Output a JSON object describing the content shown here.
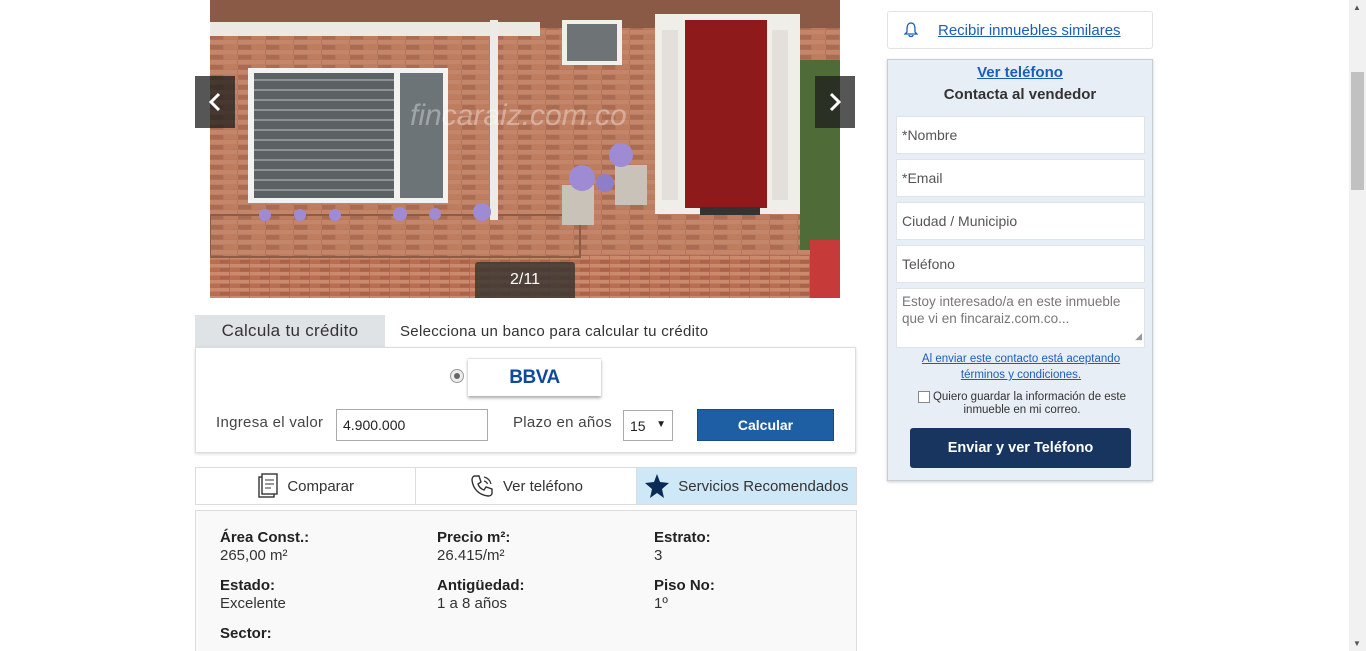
{
  "gallery": {
    "counter": "2/11",
    "watermark": "fincaraiz.com.co",
    "prev_icon": "chevron-left-icon",
    "next_icon": "chevron-right-icon"
  },
  "credit": {
    "tab_label": "Calcula tu crédito",
    "subtitle": "Selecciona un banco para calcular tu crédito",
    "bank_name": "BBVA",
    "value_label": "Ingresa el valor",
    "value": "4.900.000",
    "term_label": "Plazo en años",
    "term_value": "15",
    "calc_button": "Calcular"
  },
  "actions": {
    "compare": "Comparar",
    "phone": "Ver teléfono",
    "services": "Servicios Recomendados"
  },
  "details": {
    "area_label": "Área Const.:",
    "area_value": "265,00 m²",
    "price_m2_label": "Precio m²:",
    "price_m2_value": "26.415/m²",
    "estrato_label": "Estrato:",
    "estrato_value": "3",
    "estado_label": "Estado:",
    "estado_value": "Excelente",
    "antiguedad_label": "Antigüedad:",
    "antiguedad_value": "1 a 8 años",
    "piso_label": "Piso No:",
    "piso_value": "1º",
    "sector_label": "Sector:"
  },
  "sidebar": {
    "similar_link": "Recibir inmuebles similares",
    "similar_icon": "bell-icon",
    "phone_link": "Ver teléfono",
    "contact_title": "Contacta al vendedor",
    "name_placeholder": "*Nombre",
    "email_placeholder": "*Email",
    "city_placeholder": "Ciudad / Municipio",
    "phone_placeholder": "Teléfono",
    "message": "Estoy interesado/a en este inmueble que vi en fincaraiz.com.co...",
    "terms": "Al enviar este contacto está aceptando términos y condiciones.",
    "save_info": "Quiero guardar la información de este inmueble en mi correo.",
    "send_button": "Enviar y ver Teléfono"
  },
  "colors": {
    "primary_button": "#1e5fa3",
    "send_button": "#17355f",
    "link": "#1a5ebd",
    "services_bg": "#cfe8f7",
    "contact_bg": "#e8eef5"
  }
}
